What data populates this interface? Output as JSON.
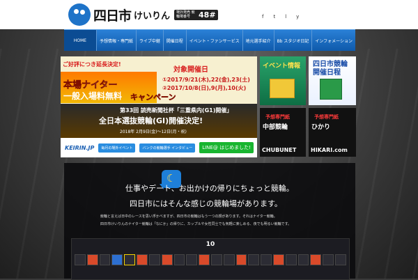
{
  "header": {
    "logo_kanji": "四日市",
    "logo_kana": "けいりん",
    "badge_text": "場外発売 競輪場番号",
    "badge_number": "48#",
    "social": [
      "f",
      "t",
      "l",
      "y"
    ]
  },
  "nav": {
    "items": [
      "HOME",
      "予想情報・専門紙",
      "ライブ中継",
      "開催日程",
      "イベント・ファンサービス",
      "地元選手紹介",
      "Bb スタジオ日記",
      "インフォメーション"
    ]
  },
  "main_banner": {
    "lead": "ご好評につき延長決定!",
    "title_line1": "本場ナイター",
    "title_line2": "一般入場料無料",
    "campaign": "キャンペーン",
    "date_heading": "対象開催日",
    "date_line1": "①2017/9/21(木),22(金),23(土)",
    "date_line2": "②2017/10/8(日),9(月),10(火)",
    "strip_line1": "第33回 読売新聞社杯「三重県内(G1)開催」",
    "strip_line2": "全日本選抜競輪(GI)開催決定!",
    "strip_line3": "2018年 2月9日(金)〜12日(月・祝)",
    "bottom_items": [
      "KEIRIN.JP",
      "毎月の場外イベント",
      "バンクの競輪選手 インタビュー",
      "LINE@ はじめました!"
    ]
  },
  "side_banners": {
    "event": {
      "title": "イベント情報"
    },
    "schedule": {
      "title": "四日市競輪 開催日程"
    },
    "chubu": {
      "label": "予想専門紙",
      "title": "中部競輪",
      "footer": "CHUBUNET"
    },
    "hikari": {
      "label": "予想専門紙",
      "title": "ひかり",
      "footer": "HIKARI.com"
    }
  },
  "panel": {
    "catch_line1": "仕事やデート、お出かけの帰りにちょっと競輪。",
    "catch_line2": "四日市にはそんな感じの競輪場があります。",
    "desc_line1": "競輪と言えば日中のレースを思い浮かべますが、四日市の競輪はもう一つの顔があります。それはナイター競輪。",
    "desc_line2": "四日市けいりんのナイター競輪は「なにか」の帰りに、カップルや女性同士でも気軽に楽しめる、夜でも明るい競輪です。",
    "calendar_month": "10"
  }
}
